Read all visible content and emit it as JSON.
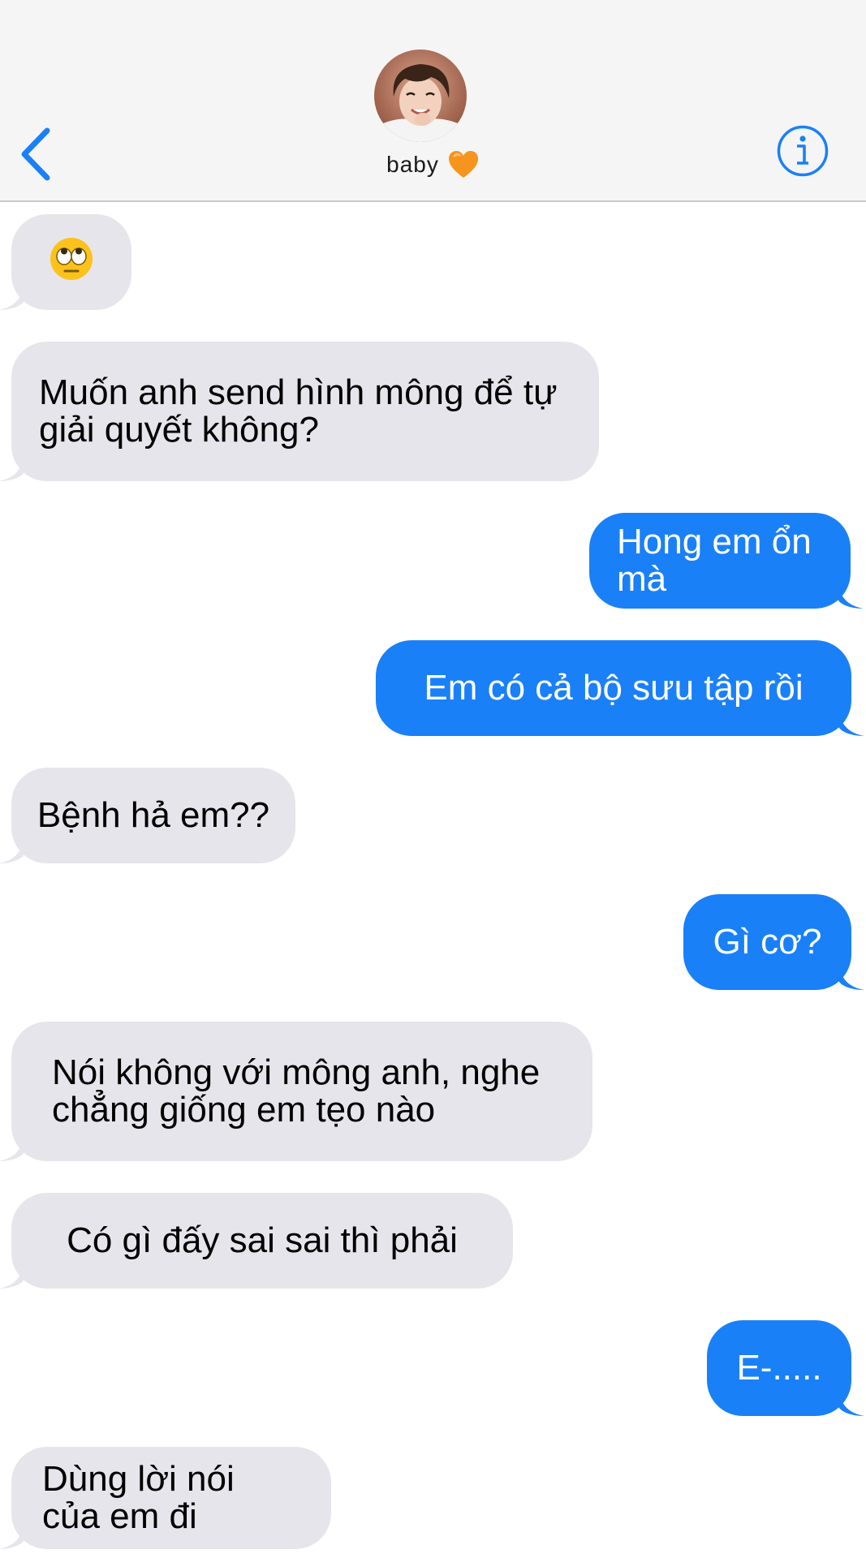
{
  "header": {
    "contact_name": "baby",
    "heart_color": "#f7941d",
    "accent_color": "#1a80f7",
    "icons": {
      "back": "chevron-left-icon",
      "info": "info-circle-icon",
      "avatar": "contact-avatar"
    }
  },
  "messages": [
    {
      "sender": "them",
      "text": "🙄"
    },
    {
      "sender": "them",
      "text": "Muốn anh send hình mông để tự giải quyết không?"
    },
    {
      "sender": "me",
      "text": "Hong em ổn mà"
    },
    {
      "sender": "me",
      "text": "Em có cả bộ sưu tập rồi"
    },
    {
      "sender": "them",
      "text": "Bệnh hả em??"
    },
    {
      "sender": "me",
      "text": "Gì cơ?"
    },
    {
      "sender": "them",
      "text": "Nói không với mông anh, nghe chẳng giống em tẹo nào"
    },
    {
      "sender": "them",
      "text": "Có gì đấy sai sai thì phải"
    },
    {
      "sender": "me",
      "text": "E-....."
    },
    {
      "sender": "them",
      "text": "Dùng lời nói của em đi"
    }
  ]
}
